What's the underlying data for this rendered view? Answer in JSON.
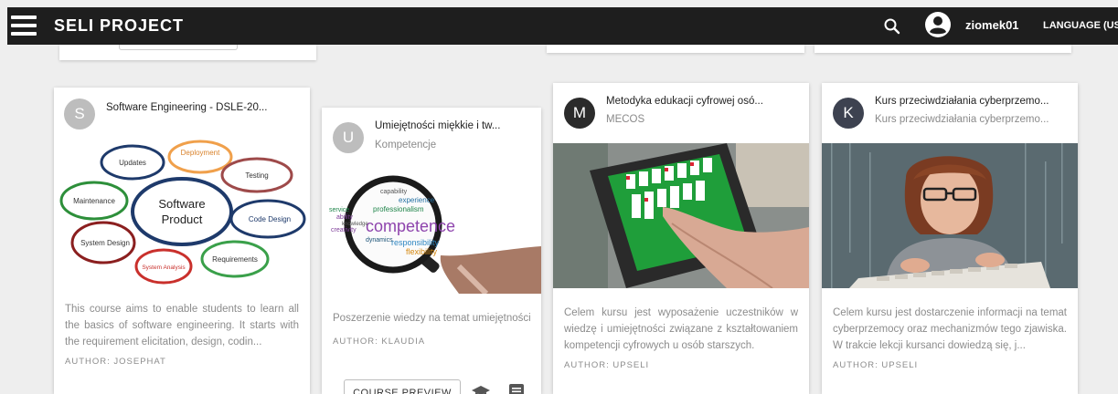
{
  "header": {
    "brand": "SELI PROJECT",
    "username": "ziomek01",
    "language": "LANGUAGE (US"
  },
  "cards": [
    {
      "letter": "S",
      "letter_color": "#bdbdbd",
      "title": "Software Engineering - DSLE-20...",
      "diagram": {
        "center_line1": "Software",
        "center_line2": "Product",
        "petals": [
          "Deployment",
          "Testing",
          "Code Design",
          "Requirements",
          "System Analysis",
          "System Design",
          "Maintenance",
          "Updates"
        ]
      },
      "description": "This course aims to enable students to learn all the basics of software engineering. It starts with the requirement elicitation, design, codin...",
      "author": "AUTHOR: JOSEPHAT"
    },
    {
      "letter": "U",
      "letter_color": "#bdbdbd",
      "title": "Umiejętności miękkie i tw...",
      "subtitle": "Kompetencje",
      "words": {
        "main": "competence",
        "w1": "responsibility",
        "w2": "flexibility",
        "w3": "experience",
        "w4": "professionalism",
        "w5": "service",
        "w6": "creativity",
        "w7": "dynamics",
        "w8": "ability",
        "w9": "knowledge",
        "w10": "capability"
      },
      "description": "Poszerzenie wiedzy na temat umiejętności",
      "author": "AUTHOR: KLAUDIA",
      "preview_label": "COURSE PREVIEW"
    },
    {
      "letter": "M",
      "letter_color": "#2b2b2b",
      "title": "Metodyka edukacji cyfrowej osó...",
      "subtitle": "MECOS",
      "description": "Celem kursu jest wyposażenie uczestników w wiedzę i umiejętności związane z kształtowaniem kompetencji cyfrowych u osób starszych.",
      "author": "AUTHOR: UPSELI"
    },
    {
      "letter": "K",
      "letter_color": "#3d4250",
      "title": "Kurs przeciwdziałania cyberprzemo...",
      "subtitle": "Kurs przeciwdziałania cyberprzemo...",
      "description": "Celem kursu jest dostarczenie informacji na temat cyberprzemocy oraz mechanizmów tego zjawiska. W trakcie lekcji kursanci dowiedzą się, j...",
      "author": "AUTHOR: UPSELI"
    }
  ]
}
